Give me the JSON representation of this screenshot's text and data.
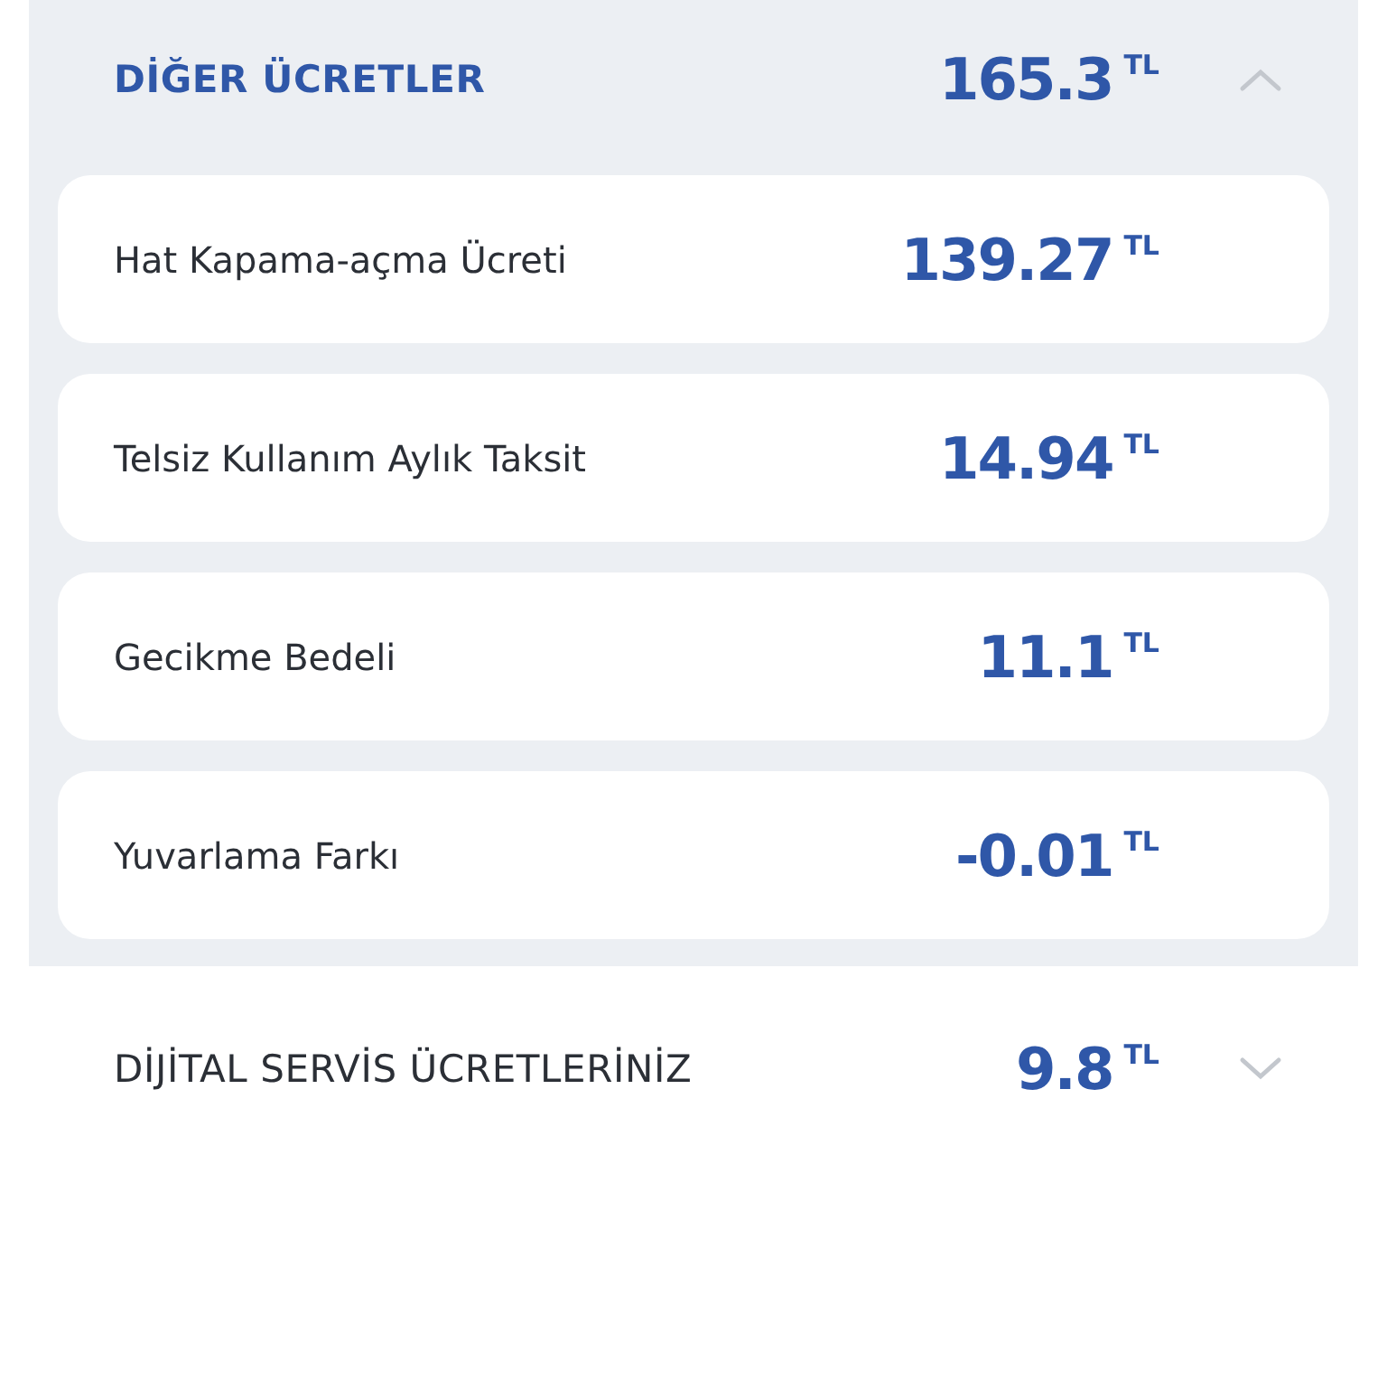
{
  "sections": [
    {
      "title": "DİĞER ÜCRETLER",
      "amount": "165.3",
      "currency": "TL",
      "expanded": true,
      "items": [
        {
          "label": "Hat Kapama-açma Ücreti",
          "amount": "139.27",
          "currency": "TL"
        },
        {
          "label": "Telsiz Kullanım Aylık Taksit",
          "amount": "14.94",
          "currency": "TL"
        },
        {
          "label": "Gecikme Bedeli",
          "amount": "11.1",
          "currency": "TL"
        },
        {
          "label": "Yuvarlama Farkı",
          "amount": "-0.01",
          "currency": "TL"
        }
      ]
    },
    {
      "title": "DİJİTAL SERVİS ÜCRETLERİNİZ",
      "amount": "9.8",
      "currency": "TL",
      "expanded": false
    }
  ]
}
